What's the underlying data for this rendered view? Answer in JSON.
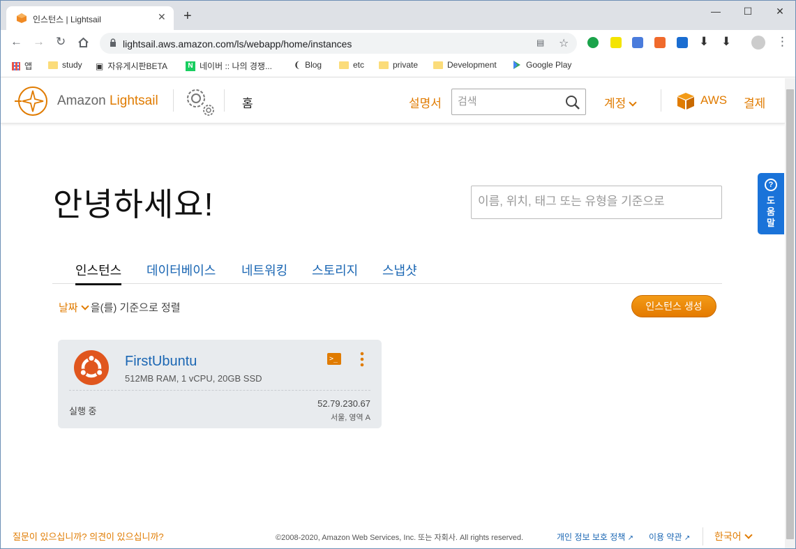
{
  "browser": {
    "tab_title": "인스턴스 | Lightsail",
    "tab_close": "✕",
    "new_tab": "+",
    "url": "lightsail.aws.amazon.com/ls/webapp/home/instances",
    "window_controls": {
      "minimize": "—",
      "maximize": "☐",
      "close": "✕"
    },
    "bookmarks": [
      {
        "label": "앱",
        "icon": "apps-grid-icon"
      },
      {
        "label": "study",
        "icon": "folder-icon"
      },
      {
        "label": "자유게시판BETA",
        "icon": "site-icon"
      },
      {
        "label": "네이버 :: 나의 경쟁...",
        "icon": "naver-icon"
      },
      {
        "label": "Blog",
        "icon": "blog-icon"
      },
      {
        "label": "etc",
        "icon": "folder-icon"
      },
      {
        "label": "private",
        "icon": "folder-icon"
      },
      {
        "label": "Development",
        "icon": "folder-icon"
      },
      {
        "label": "Google Play",
        "icon": "google-play-icon"
      }
    ]
  },
  "header": {
    "logo_text_prefix": "Amazon ",
    "logo_text_brand": "Lightsail",
    "home": "홈",
    "docs": "설명서",
    "search_placeholder": "검색",
    "account": "계정",
    "aws": "AWS",
    "billing": "결제"
  },
  "main": {
    "greeting": "안녕하세요!",
    "filter_placeholder": "이름, 위치, 태그 또는 유형을 기준으로",
    "tabs": [
      {
        "label": "인스턴스",
        "active": true
      },
      {
        "label": "데이터베이스",
        "active": false
      },
      {
        "label": "네트워킹",
        "active": false
      },
      {
        "label": "스토리지",
        "active": false
      },
      {
        "label": "스냅샷",
        "active": false
      }
    ],
    "sort_by": "날짜",
    "sort_suffix": "을(를) 기준으로 정렬",
    "create_button": "인스턴스 생성"
  },
  "instance": {
    "name": "FirstUbuntu",
    "spec": "512MB RAM, 1 vCPU, 20GB SSD",
    "status": "실행 중",
    "ip": "52.79.230.67",
    "zone": "서울, 영역 A",
    "terminal_label": ">_"
  },
  "help_tab": {
    "label": "도움말",
    "icon": "?"
  },
  "footer": {
    "question": "질문이 있으십니까? 의견이 있으십니까?",
    "copyright": "©2008-2020, Amazon Web Services, Inc. 또는 자회사. All rights reserved.",
    "privacy": "개인 정보 보호 정책",
    "terms": "이용 약관",
    "language": "한국어"
  },
  "colors": {
    "accent": "#e07b00",
    "link": "#1a66b3",
    "help": "#1a73d9"
  }
}
